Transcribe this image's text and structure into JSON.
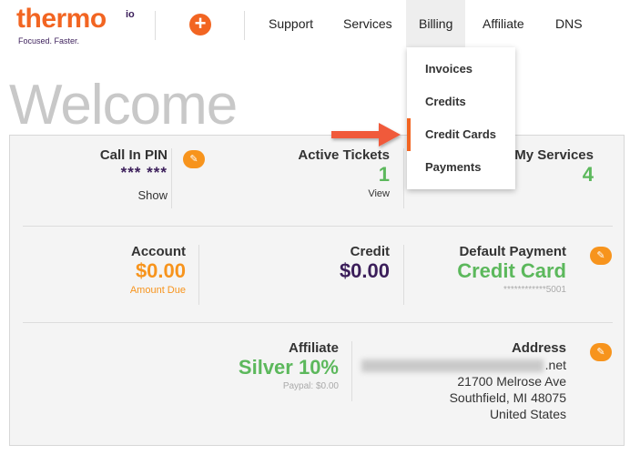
{
  "brand": {
    "name": "thermo",
    "suffix": "io",
    "tagline": "Focused. Faster."
  },
  "nav": {
    "support": "Support",
    "services": "Services",
    "billing": "Billing",
    "affiliate": "Affiliate",
    "dns": "DNS"
  },
  "add_label": "+",
  "billing_menu": {
    "invoices": "Invoices",
    "credits": "Credits",
    "credit_cards": "Credit Cards",
    "payments": "Payments"
  },
  "page": {
    "title": "Welcome"
  },
  "pin": {
    "label": "Call In PIN",
    "value": "*** ***",
    "action": "Show"
  },
  "tickets": {
    "label": "Active Tickets",
    "value": "1",
    "action": "View"
  },
  "services_stat": {
    "label": "My Services",
    "value": "4"
  },
  "account": {
    "label": "Account",
    "value": "$0.00",
    "sub": "Amount Due"
  },
  "credit": {
    "label": "Credit",
    "value": "$0.00"
  },
  "payment": {
    "label": "Default Payment",
    "value": "Credit Card",
    "sub": "************5001"
  },
  "affiliate": {
    "label": "Affiliate",
    "value": "Silver 10%",
    "sub": "Paypal: $0.00"
  },
  "address": {
    "label": "Address",
    "email_tail": ".net",
    "line1": "21700 Melrose Ave",
    "line2": "Southfield, MI 48075",
    "line3": "United States"
  },
  "colors": {
    "brand_orange": "#f26522",
    "edit_orange": "#f7941d",
    "green": "#5cb85c",
    "purple": "#3b1e5a",
    "orange_value": "#f7941d"
  },
  "icons": {
    "edit": "edit-icon",
    "add": "plus-icon",
    "arrow": "arrow-right-icon"
  }
}
